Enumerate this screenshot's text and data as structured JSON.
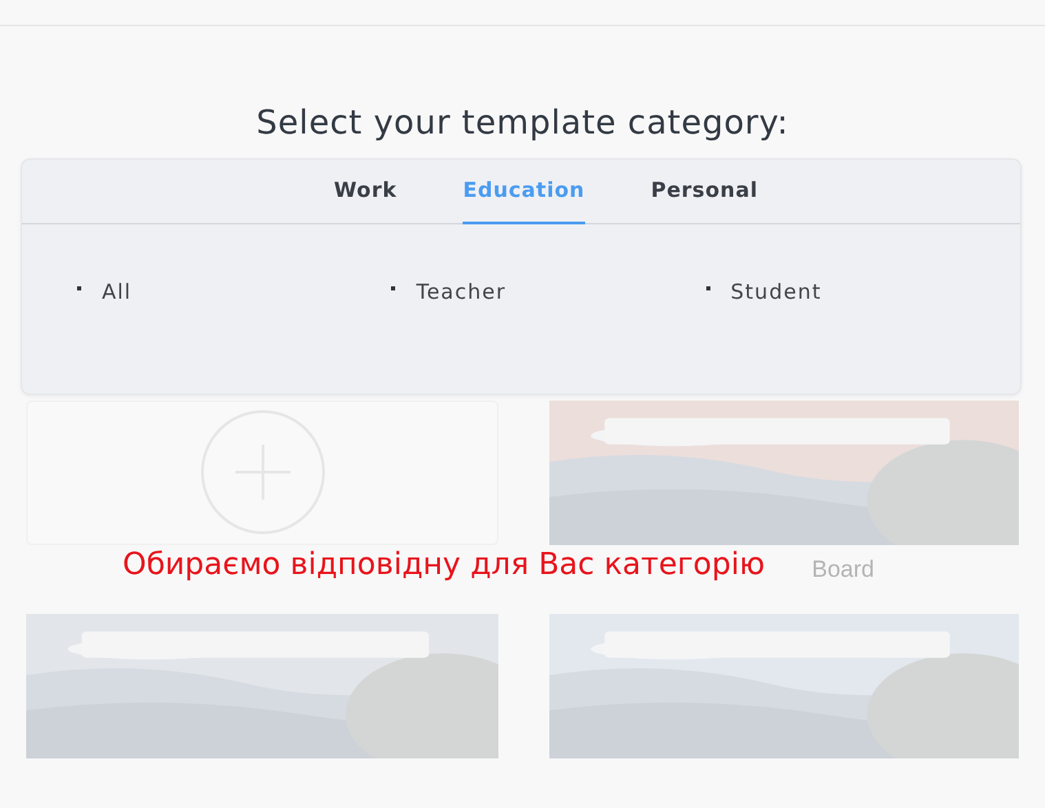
{
  "heading": "Select your template category:",
  "tabs": [
    {
      "label": "Work",
      "selected": false
    },
    {
      "label": "Education",
      "selected": true
    },
    {
      "label": "Personal",
      "selected": false
    }
  ],
  "subcategories": [
    "All",
    "Teacher",
    "Student"
  ],
  "cards": [
    {
      "kind": "blank"
    },
    {
      "kind": "picture",
      "caption": "Board"
    },
    {
      "kind": "picture"
    },
    {
      "kind": "picture"
    }
  ],
  "annotation": "Обираємо відповідну для Вас категорію"
}
